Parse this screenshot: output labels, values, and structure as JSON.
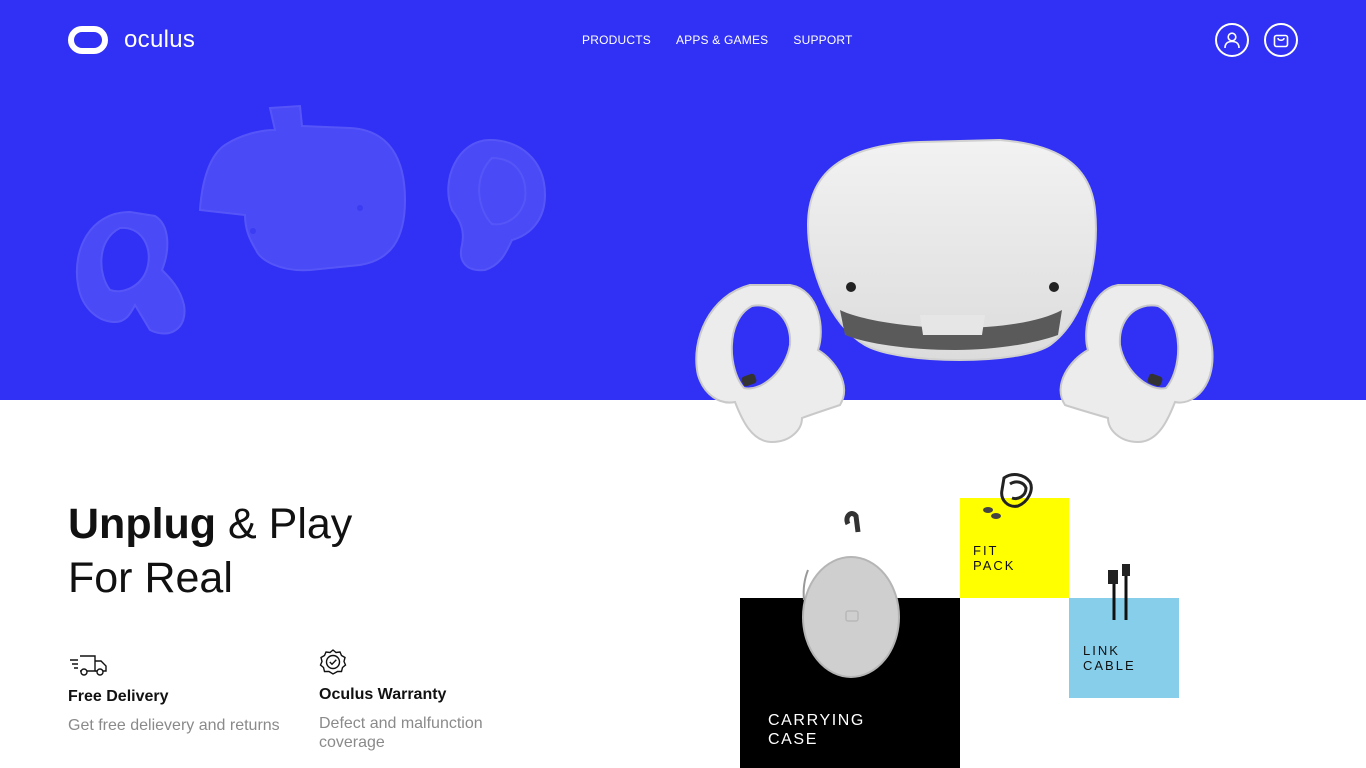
{
  "brand": {
    "name": "oculus"
  },
  "nav": [
    {
      "label": "PRODUCTS"
    },
    {
      "label": "APPS & GAMES"
    },
    {
      "label": "SUPPORT"
    }
  ],
  "header_icons": [
    "user-icon",
    "cart-icon"
  ],
  "hero": {
    "headline_bold": "Unplug",
    "headline_rest": " & Play",
    "headline_line2": "For Real"
  },
  "features": [
    {
      "icon": "delivery-truck-icon",
      "title": "Free Delivery",
      "description": "Get free delievery and returns"
    },
    {
      "icon": "warranty-badge-icon",
      "title": "Oculus Warranty",
      "description": "Defect and malfunction coverage"
    }
  ],
  "accessories": [
    {
      "label": "CARRYING\nCASE",
      "color": "#000000"
    },
    {
      "label": "FIT\nPACK",
      "color": "#ffff00"
    },
    {
      "label": "LINK\nCABLE",
      "color": "#87ceeb"
    }
  ],
  "colors": {
    "hero_background": "#3131f5",
    "text": "#111111",
    "muted": "#8a8a8a"
  }
}
